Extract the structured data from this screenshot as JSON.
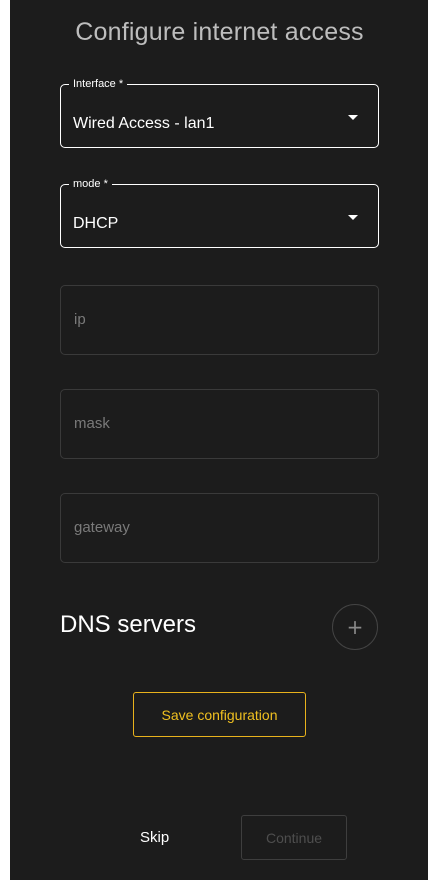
{
  "page": {
    "title": "Configure internet access"
  },
  "interface_field": {
    "label": "Interface *",
    "value": "Wired Access - lan1"
  },
  "mode_field": {
    "label": "mode *",
    "value": "DHCP"
  },
  "ip_field": {
    "placeholder": "ip"
  },
  "mask_field": {
    "placeholder": "mask"
  },
  "gateway_field": {
    "placeholder": "gateway"
  },
  "dns": {
    "label": "DNS servers",
    "add_icon": "plus-icon",
    "add_glyph": "+"
  },
  "actions": {
    "save_label": "Save configuration",
    "skip_label": "Skip",
    "continue_label": "Continue"
  },
  "colors": {
    "background": "#1c1c1c",
    "accent": "#f0c020",
    "text": "#ffffff",
    "muted": "#7a7a7a"
  }
}
